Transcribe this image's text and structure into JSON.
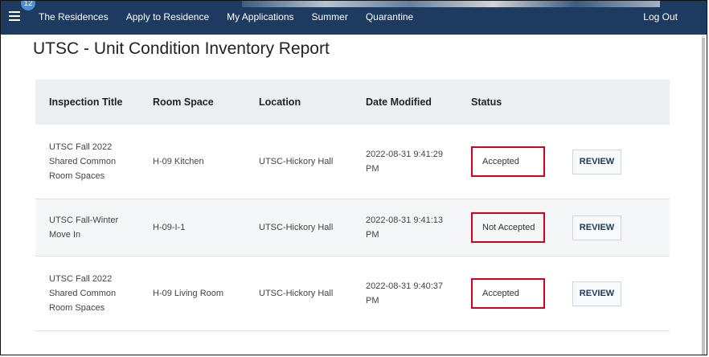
{
  "navbar": {
    "badge_count": "12",
    "links": [
      "The Residences",
      "Apply to Residence",
      "My Applications",
      "Summer",
      "Quarantine"
    ],
    "logout_label": "Log Out"
  },
  "page": {
    "title": "UTSC - Unit Condition Inventory Report"
  },
  "table": {
    "headers": [
      "Inspection Title",
      "Room Space",
      "Location",
      "Date Modified",
      "Status"
    ],
    "rows": [
      {
        "title_lines": [
          "UTSC Fall 2022",
          "Shared Common",
          "Room Spaces"
        ],
        "room_space": "H-09 Kitchen",
        "location": "UTSC-Hickory Hall",
        "date_lines": [
          "2022-08-31 9:41:29",
          "PM"
        ],
        "status": "Accepted",
        "action": "REVIEW"
      },
      {
        "title_lines": [
          "UTSC Fall-Winter",
          "Move In"
        ],
        "room_space": "H-09-I-1",
        "location": "UTSC-Hickory Hall",
        "date_lines": [
          "2022-08-31 9:41:13",
          "PM"
        ],
        "status": "Not Accepted",
        "action": "REVIEW"
      },
      {
        "title_lines": [
          "UTSC Fall 2022",
          "Shared Common",
          "Room Spaces"
        ],
        "room_space": "H-09 Living Room",
        "location": "UTSC-Hickory Hall",
        "date_lines": [
          "2022-08-31 9:40:37",
          "PM"
        ],
        "status": "Accepted",
        "action": "REVIEW"
      }
    ]
  },
  "colors": {
    "navbar_bg": "#1d3b60",
    "highlight_border": "#d9001b",
    "header_row_bg": "#eceff1"
  }
}
